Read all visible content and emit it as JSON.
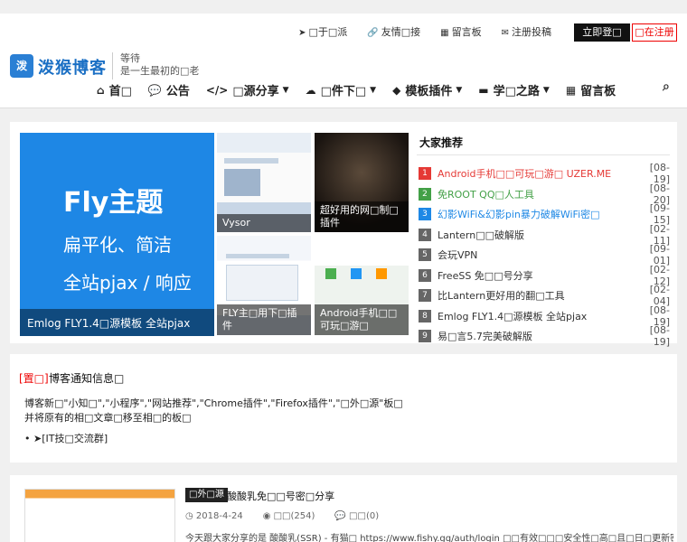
{
  "top_links": [
    {
      "icon": "pointer-icon",
      "glyph": "➤",
      "label": "□于□派"
    },
    {
      "icon": "link-icon",
      "glyph": "🔗",
      "label": "友情□接"
    },
    {
      "icon": "guestbook-icon",
      "glyph": "▦",
      "label": "留言板"
    },
    {
      "icon": "envelope-icon",
      "glyph": "✉",
      "label": "注册投稿"
    }
  ],
  "auth": {
    "login": "立即登□",
    "register": "□在注册"
  },
  "logo": {
    "badge": "泼",
    "text": "泼猴博客",
    "slogan_line1": "等待",
    "slogan_line2": "是一生最初的□老"
  },
  "nav": [
    {
      "icon": "home-icon",
      "glyph": "⌂",
      "label": "首□",
      "dropdown": false
    },
    {
      "icon": "chat-icon",
      "glyph": "💬",
      "label": "公告",
      "dropdown": false
    },
    {
      "icon": "code-icon",
      "glyph": "</>",
      "label": "□源分享",
      "dropdown": true
    },
    {
      "icon": "cloud-download-icon",
      "glyph": "☁",
      "label": "□件下□",
      "dropdown": true
    },
    {
      "icon": "cube-icon",
      "glyph": "◆",
      "label": "模板插件",
      "dropdown": true
    },
    {
      "icon": "keyboard-icon",
      "glyph": "▬",
      "label": "学□之路",
      "dropdown": true
    },
    {
      "icon": "calendar-icon",
      "glyph": "▦",
      "label": "留言板",
      "dropdown": false
    }
  ],
  "featured": {
    "big": {
      "line1": "Fly主题",
      "line2": "扁平化、简洁",
      "line3": "全站pjax / 响应",
      "caption": "Emlog FLY1.4□源模板 全站pjax"
    },
    "thumbs": [
      {
        "caption": "Vysor"
      },
      {
        "caption": "超好用的网□制□插件"
      },
      {
        "caption": "FLY主□用下□插件"
      },
      {
        "caption": "Android手机□□可玩□游□"
      }
    ]
  },
  "recommend": {
    "title": "大家推荐",
    "items": [
      {
        "num": "1",
        "color": "#e53935",
        "text": "Android手机□□可玩□游□ UZER.ME",
        "date": "[08-19]",
        "text_color": "#e53935"
      },
      {
        "num": "2",
        "color": "#43a047",
        "text": "免ROOT QQ□人工具",
        "date": "[08-20]",
        "text_color": "#43a047"
      },
      {
        "num": "3",
        "color": "#1e88e5",
        "text": "幻影WiFi&幻影pin暴力破解WiFi密□",
        "date": "[09-15]",
        "text_color": "#1e88e5"
      },
      {
        "num": "4",
        "color": "#666666",
        "text": "Lantern□□破解版",
        "date": "[02-11]",
        "text_color": "#333333"
      },
      {
        "num": "5",
        "color": "#666666",
        "text": "会玩VPN",
        "date": "[09-01]",
        "text_color": "#333333"
      },
      {
        "num": "6",
        "color": "#666666",
        "text": "FreeSS 免□□号分享",
        "date": "[02-12]",
        "text_color": "#333333"
      },
      {
        "num": "7",
        "color": "#666666",
        "text": "比Lantern更好用的翻□工具",
        "date": "[02-04]",
        "text_color": "#333333"
      },
      {
        "num": "8",
        "color": "#666666",
        "text": "Emlog FLY1.4□源模板 全站pjax",
        "date": "[08-19]",
        "text_color": "#333333"
      },
      {
        "num": "9",
        "color": "#666666",
        "text": "易□言5.7完美破解版",
        "date": "[08-19]",
        "text_color": "#333333"
      }
    ]
  },
  "notice": {
    "tag": "[置□]",
    "title": "博客通知信息□",
    "line1": "博客新□\"小知□\",\"小程序\",\"网站推荐\",\"Chrome插件\",\"Firefox插件\",\"□外□源\"板□",
    "line2": "并将原有的相□文章□移至相□的板□",
    "bullet": "[IT技□交流群]"
  },
  "post": {
    "category": "□外□源",
    "title": "酸酸乳免□□号密□分享",
    "date": "2018-4-24",
    "views": "□□(254)",
    "comments": "□□(0)",
    "excerpt": "今天跟大家分享的是 酸酸乳(SSR) - 有猫□ https://www.fishy.gq/auth/login □□有效□□□安全性□高□且□日□更新密□□"
  }
}
